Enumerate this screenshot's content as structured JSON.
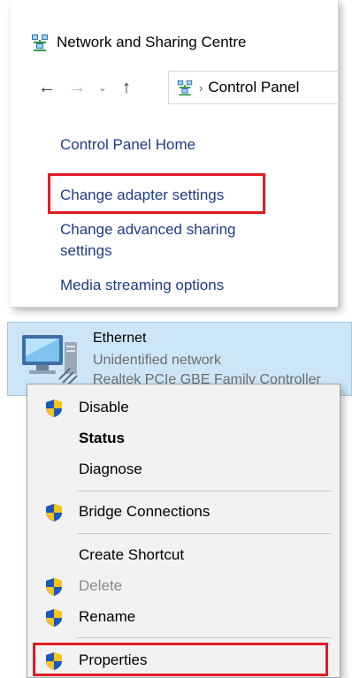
{
  "window": {
    "title": "Network and Sharing Centre",
    "address_crumb": "Control Panel"
  },
  "left_links": [
    "Control Panel Home",
    "Change adapter settings",
    "Change advanced sharing",
    "settings",
    "Media streaming options"
  ],
  "adapter": {
    "name": "Ethernet",
    "status": "Unidentified network",
    "device": "Realtek PCIe GBE Family Controller"
  },
  "menu": {
    "disable": "Disable",
    "status": "Status",
    "diagnose": "Diagnose",
    "bridge": "Bridge Connections",
    "create_shortcut": "Create Shortcut",
    "delete": "Delete",
    "rename": "Rename",
    "properties": "Properties"
  },
  "colors": {
    "highlight_box": "#e01b24",
    "link": "#1f3c88",
    "selection_bg": "#cde6f7"
  }
}
